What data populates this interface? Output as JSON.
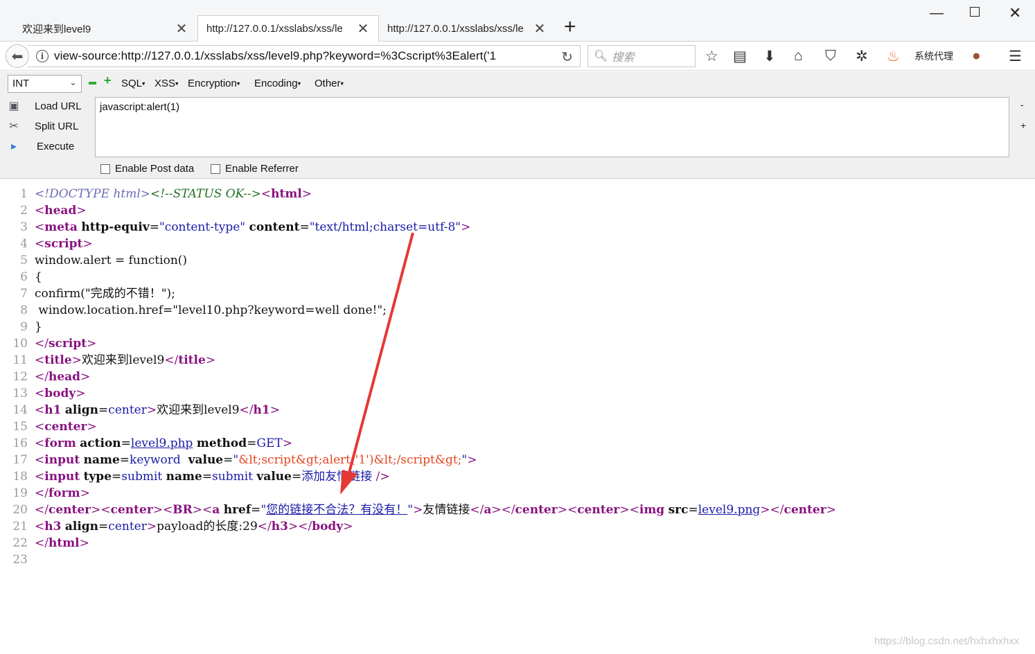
{
  "tabs": [
    {
      "title": "欢迎来到level9",
      "active": false
    },
    {
      "title": "http://127.0.0.1/xsslabs/xss/le",
      "active": true
    },
    {
      "title": "http://127.0.0.1/xsslabs/xss/le",
      "active": false
    }
  ],
  "url": "view-source:http://127.0.0.1/xsslabs/xss/level9.php?keyword=%3Cscript%3Ealert('1",
  "search_placeholder": "搜索",
  "proxy_label": "系统代理",
  "hackbar": {
    "type_select": "INT",
    "menus": [
      "SQL",
      "XSS",
      "Encryption",
      "Encoding",
      "Other"
    ],
    "load_url": "Load URL",
    "split_url": "Split URL",
    "execute": "Execute",
    "textarea": "javascript:alert(1)",
    "side_minus": "-",
    "side_plus": "+",
    "enable_post": "Enable Post data",
    "enable_referrer": "Enable Referrer"
  },
  "source_lines": [
    {
      "n": "1"
    },
    {
      "n": "2"
    },
    {
      "n": "3"
    },
    {
      "n": "4"
    },
    {
      "n": "5"
    },
    {
      "n": "6"
    },
    {
      "n": "7"
    },
    {
      "n": "8"
    },
    {
      "n": "9"
    },
    {
      "n": "10"
    },
    {
      "n": "11"
    },
    {
      "n": "12"
    },
    {
      "n": "13"
    },
    {
      "n": "14"
    },
    {
      "n": "15"
    },
    {
      "n": "16"
    },
    {
      "n": "17"
    },
    {
      "n": "18"
    },
    {
      "n": "19"
    },
    {
      "n": "20"
    },
    {
      "n": "21"
    },
    {
      "n": "22"
    },
    {
      "n": "23"
    }
  ],
  "code": {
    "l5": "window.alert = function()",
    "l6": "{",
    "l7": "confirm(\"完成的不错！\");",
    "l8": " window.location.href=\"level10.php?keyword=well done!\";",
    "l9": "}",
    "title_text": "欢迎来到level9",
    "h1_text": "欢迎来到level9",
    "form_action": "level9.php",
    "input_value": "&lt;script&gt;alert('1')&lt;/script&gt;",
    "submit_value": "添加友情链接",
    "href_value": "您的链接不合法？有没有！",
    "link_text": "友情链接",
    "img_src": "level9.png",
    "h3_text": "payload的长度:29"
  },
  "watermark": "https://blog.csdn.net/hxhxhxhxx",
  "colors": {
    "annotation_arrow": "#e53935"
  }
}
